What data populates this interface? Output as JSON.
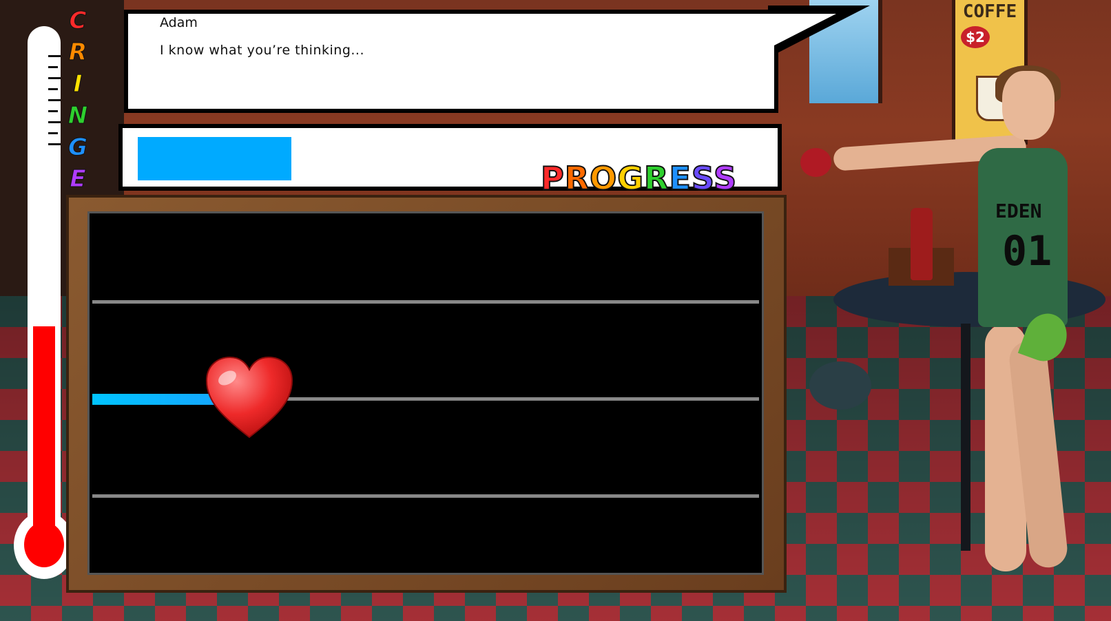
{
  "dialogue": {
    "speaker": "Adam",
    "line": "I know what you’re thinking..."
  },
  "cringe_meter": {
    "label_letters": [
      "C",
      "R",
      "I",
      "N",
      "G",
      "E"
    ],
    "letter_colors": [
      "#ff2a2a",
      "#ff8a00",
      "#ffe100",
      "#2ed02e",
      "#1e90ff",
      "#b03cff"
    ],
    "level": 0.43,
    "fill_color": "#ff0000"
  },
  "progress": {
    "label": "PROGRESS",
    "label_colors": [
      "#ff2a2a",
      "#ff6a00",
      "#ff9900",
      "#ffd000",
      "#2ed02e",
      "#1e90ff",
      "#6a4cff",
      "#b03cff"
    ],
    "value": 0.24,
    "fill_color": "#00aaff"
  },
  "board": {
    "lanes": 4,
    "player_lane": 2,
    "player_icon": "heart-icon",
    "trail_color": "#00c4ff"
  },
  "scene": {
    "poster_text": "COFFE",
    "poster_price": "$2",
    "jersey_text": "EDEN",
    "jersey_number": "01"
  }
}
